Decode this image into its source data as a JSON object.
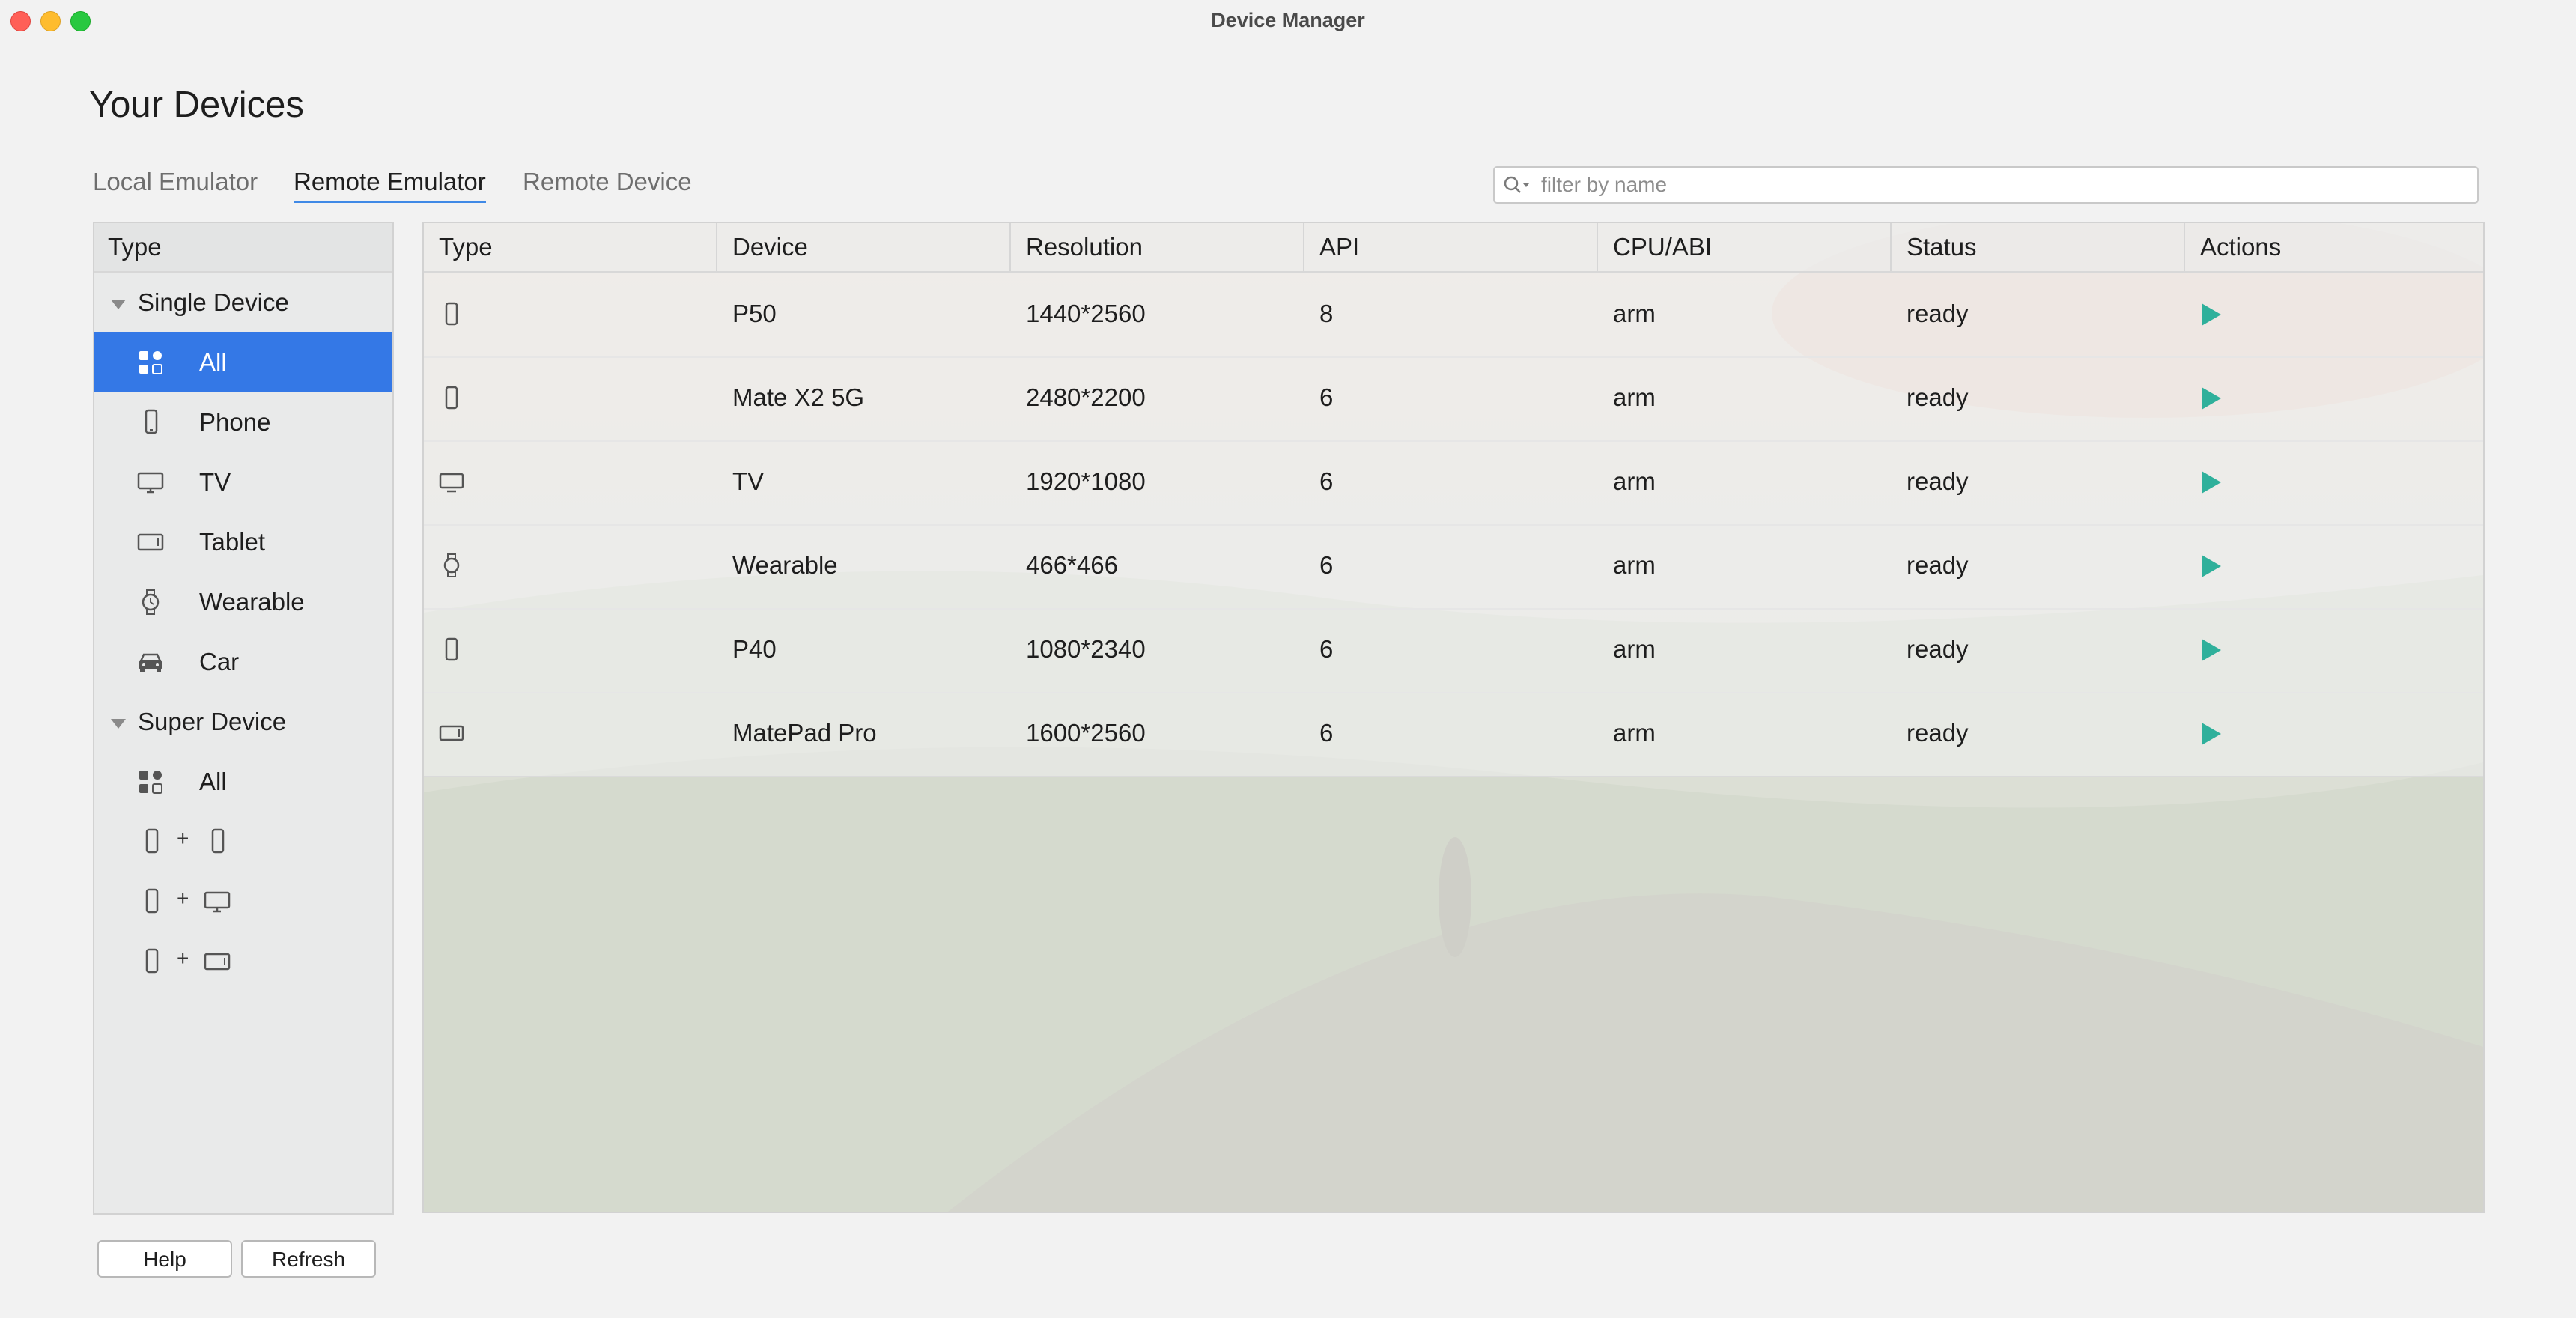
{
  "window": {
    "title": "Device Manager"
  },
  "page": {
    "title": "Your Devices"
  },
  "tabs": [
    {
      "label": "Local Emulator"
    },
    {
      "label": "Remote Emulator",
      "active": true
    },
    {
      "label": "Remote Device"
    }
  ],
  "search": {
    "placeholder": "filter by name",
    "value": ""
  },
  "sidebar": {
    "header": "Type",
    "single_group": {
      "label": "Single Device",
      "items": [
        {
          "label": "All",
          "icon": "grid-icon",
          "selected": true
        },
        {
          "label": "Phone",
          "icon": "phone-icon"
        },
        {
          "label": "TV",
          "icon": "tv-icon"
        },
        {
          "label": "Tablet",
          "icon": "tablet-icon"
        },
        {
          "label": "Wearable",
          "icon": "watch-icon"
        },
        {
          "label": "Car",
          "icon": "car-icon"
        }
      ]
    },
    "super_group": {
      "label": "Super Device",
      "items": [
        {
          "label": "All",
          "icon": "grid-icon"
        },
        {
          "icons": [
            "phone-icon",
            "phone-icon"
          ],
          "plus": "+"
        },
        {
          "icons": [
            "phone-icon",
            "tv-icon"
          ],
          "plus": "+"
        },
        {
          "icons": [
            "phone-icon",
            "tablet-icon"
          ],
          "plus": "+"
        }
      ]
    }
  },
  "table": {
    "columns": [
      "Type",
      "Device",
      "Resolution",
      "API",
      "CPU/ABI",
      "Status",
      "Actions"
    ],
    "rows": [
      {
        "icon": "phone-icon",
        "device": "P50",
        "resolution": "1440*2560",
        "api": "8",
        "cpu": "arm",
        "status": "ready",
        "action_icon": "play-icon"
      },
      {
        "icon": "phone-icon",
        "device": "Mate X2 5G",
        "resolution": "2480*2200",
        "api": "6",
        "cpu": "arm",
        "status": "ready",
        "action_icon": "play-icon"
      },
      {
        "icon": "tv-icon",
        "device": "TV",
        "resolution": "1920*1080",
        "api": "6",
        "cpu": "arm",
        "status": "ready",
        "action_icon": "play-icon"
      },
      {
        "icon": "watch-icon",
        "device": "Wearable",
        "resolution": "466*466",
        "api": "6",
        "cpu": "arm",
        "status": "ready",
        "action_icon": "play-icon"
      },
      {
        "icon": "phone-icon",
        "device": "P40",
        "resolution": "1080*2340",
        "api": "6",
        "cpu": "arm",
        "status": "ready",
        "action_icon": "play-icon"
      },
      {
        "icon": "tablet-icon",
        "device": "MatePad Pro",
        "resolution": "1600*2560",
        "api": "6",
        "cpu": "arm",
        "status": "ready",
        "action_icon": "play-icon"
      }
    ]
  },
  "buttons": {
    "help": "Help",
    "refresh": "Refresh"
  },
  "colors": {
    "selection": "#3478e6",
    "tab_underline": "#3f89e6",
    "play": "#2fb09b"
  }
}
